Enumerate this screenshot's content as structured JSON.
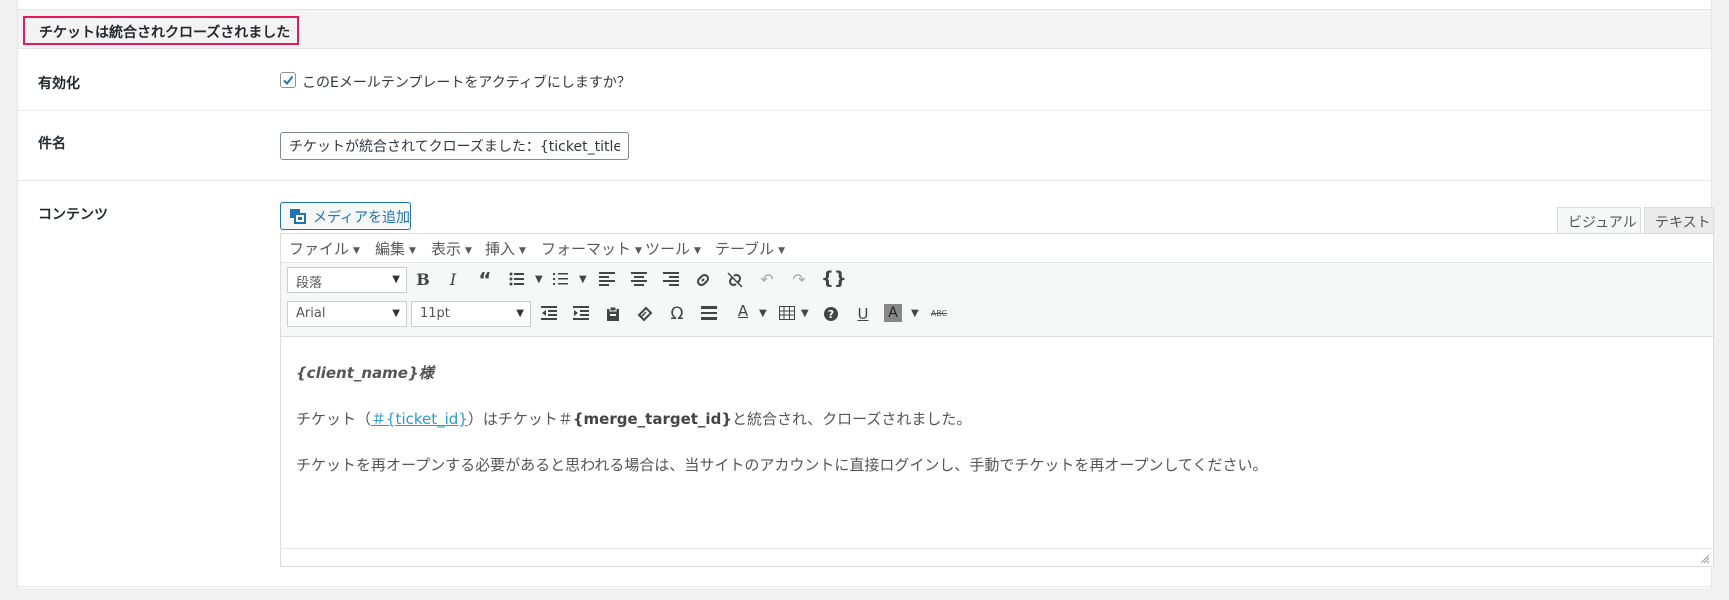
{
  "section": {
    "title": "チケットは統合されクローズされました"
  },
  "enable": {
    "label": "有効化",
    "checkbox_label": "このEメールテンプレートをアクティブにしますか？",
    "checked": true
  },
  "subject": {
    "label": "件名",
    "value": "チケットが統合されてクローズました：{ticket_title}"
  },
  "content": {
    "label": "コンテンツ"
  },
  "editor": {
    "add_media": "メディアを追加",
    "tabs": {
      "visual": "ビジュアル",
      "text": "テキスト"
    },
    "menu": [
      "ファイル",
      "編集",
      "表示",
      "挿入",
      "フォーマット",
      "ツール",
      "テーブル"
    ],
    "format_select": "段落",
    "font_select": "Arial",
    "size_select": "11pt",
    "body": {
      "line1": "{client_name}様",
      "line2_pre": "チケット（",
      "line2_link": "＃{ticket_id}",
      "line2_mid": "）はチケット＃",
      "line2_bold": "{merge_target_id}",
      "line2_post": "と統合され、クローズされました。",
      "line3": "チケットを再オープンする必要があると思われる場合は、当サイトのアカウントに直接ログインし、手動でチケットを再オープンしてください。"
    }
  },
  "icons": [
    "checkbox-check-icon",
    "add-media-icon",
    "bold-icon",
    "italic-icon",
    "blockquote-icon",
    "bullet-list-icon",
    "numbered-list-icon",
    "align-left-icon",
    "align-center-icon",
    "align-right-icon",
    "link-icon",
    "unlink-icon",
    "undo-icon",
    "redo-icon",
    "code-braces-icon",
    "outdent-icon",
    "indent-icon",
    "paste-text-icon",
    "clear-format-icon",
    "omega-icon",
    "horizontal-rule-icon",
    "text-color-icon",
    "table-icon",
    "help-icon",
    "underline-icon",
    "background-color-icon",
    "strikethrough-icon",
    "resize-grip-icon"
  ],
  "colors": {
    "highlight_border": "#e8175d",
    "link": "#2a9bd1",
    "primary": "#2271b1"
  }
}
